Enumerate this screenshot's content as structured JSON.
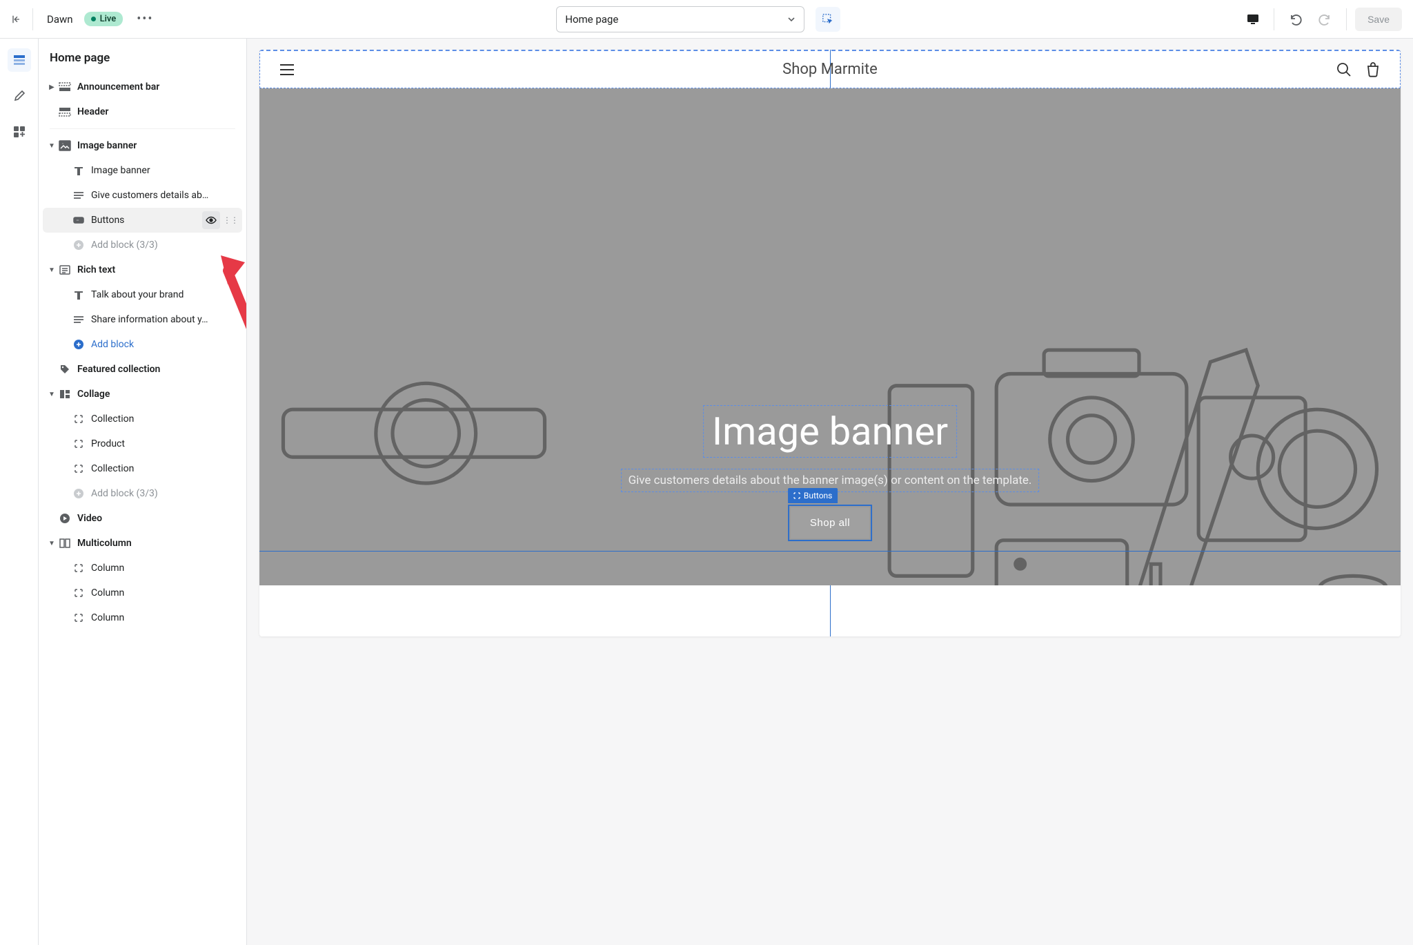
{
  "topbar": {
    "theme_name": "Dawn",
    "live_label": "Live",
    "page_select": "Home page",
    "save_label": "Save"
  },
  "sidebar": {
    "title": "Home page",
    "items": {
      "announcement": "Announcement bar",
      "header": "Header",
      "image_banner": "Image banner",
      "ib_heading": "Image banner",
      "ib_text": "Give customers details ab…",
      "ib_buttons": "Buttons",
      "ib_add": "Add block (3/3)",
      "rich_text": "Rich text",
      "rt_heading": "Talk about your brand",
      "rt_text": "Share information about y…",
      "rt_add": "Add block",
      "featured": "Featured collection",
      "collage": "Collage",
      "col_1": "Collection",
      "col_2": "Product",
      "col_3": "Collection",
      "col_add": "Add block (3/3)",
      "video": "Video",
      "multicolumn": "Multicolumn",
      "mc_1": "Column",
      "mc_2": "Column",
      "mc_3": "Column"
    }
  },
  "preview": {
    "shop_name": "Shop Marmite",
    "banner_heading": "Image banner",
    "banner_text": "Give customers details about the banner image(s) or content on the template.",
    "button_label": "Shop all",
    "block_tag": "Buttons"
  }
}
